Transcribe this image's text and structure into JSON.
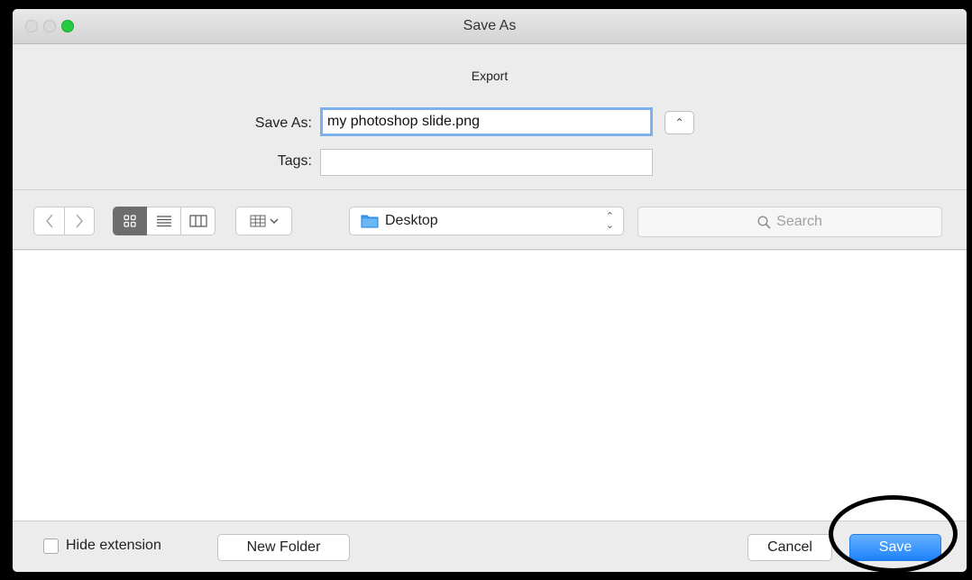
{
  "window": {
    "title": "Save As"
  },
  "dialog": {
    "format_label": "Export",
    "save_as_label": "Save As:",
    "save_as_value": "my photoshop slide.png",
    "tags_label": "Tags:",
    "tags_value": ""
  },
  "toolbar": {
    "back_icon": "chevron-left-icon",
    "forward_icon": "chevron-right-icon",
    "view_modes": [
      "icon-view",
      "list-view",
      "column-view"
    ],
    "active_view": "icon-view",
    "location": "Desktop",
    "search_placeholder": "Search"
  },
  "footer": {
    "hide_extension_label": "Hide extension",
    "hide_extension_checked": false,
    "new_folder_label": "New Folder",
    "cancel_label": "Cancel",
    "save_label": "Save"
  },
  "colors": {
    "accent": "#1d82fb",
    "zoom_button": "#27c93f",
    "focus_ring": "#7ab1ee"
  }
}
